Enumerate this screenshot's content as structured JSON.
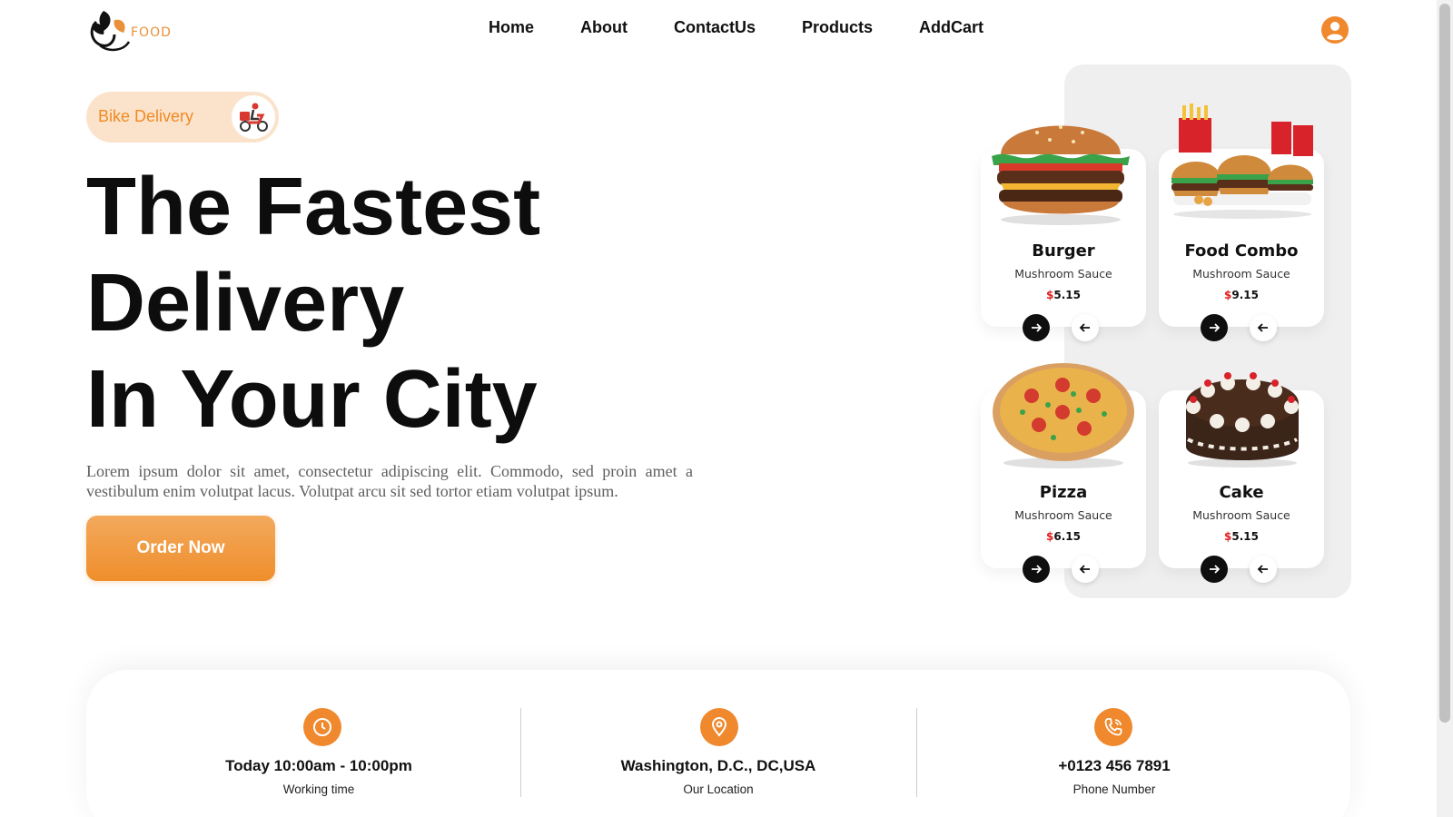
{
  "brand": {
    "logo_text": "FOOD"
  },
  "nav": {
    "items": [
      {
        "label": "Home"
      },
      {
        "label": "About"
      },
      {
        "label": "ContactUs"
      },
      {
        "label": "Products"
      },
      {
        "label": "AddCart"
      }
    ],
    "user_icon": "user-circle-icon"
  },
  "hero": {
    "badge_label": "Bike Delivery",
    "badge_icon": "delivery-scooter-icon",
    "title_lines": [
      "The Fastest",
      "Delivery",
      "In Your City"
    ],
    "description": "Lorem ipsum dolor sit amet, consectetur adipiscing elit. Commodo, sed proin amet a vestibulum enim volutpat lacus. Volutpat arcu sit sed tortor etiam volutpat ipsum.",
    "cta_label": "Order Now"
  },
  "products": [
    {
      "name": "Burger",
      "subtitle": "Mushroom Sauce",
      "currency": "$",
      "price": "5.15",
      "image": "burger"
    },
    {
      "name": "Food Combo",
      "subtitle": "Mushroom Sauce",
      "currency": "$",
      "price": "9.15",
      "image": "food-combo"
    },
    {
      "name": "Pizza",
      "subtitle": "Mushroom Sauce",
      "currency": "$",
      "price": "6.15",
      "image": "pizza"
    },
    {
      "name": "Cake",
      "subtitle": "Mushroom Sauce",
      "currency": "$",
      "price": "5.15",
      "image": "cake"
    }
  ],
  "info": [
    {
      "title": "Today 10:00am - 10:00pm",
      "subtitle": "Working time",
      "icon": "clock-icon"
    },
    {
      "title": "Washington, D.C., DC,USA",
      "subtitle": "Our Location",
      "icon": "location-pin-icon"
    },
    {
      "title": "+0123 456 7891",
      "subtitle": "Phone Number",
      "icon": "phone-icon"
    }
  ],
  "colors": {
    "accent": "#f0882d",
    "badge_bg": "#fbe3cb",
    "price_currency": "#e02020",
    "dark": "#0f0f0f"
  }
}
